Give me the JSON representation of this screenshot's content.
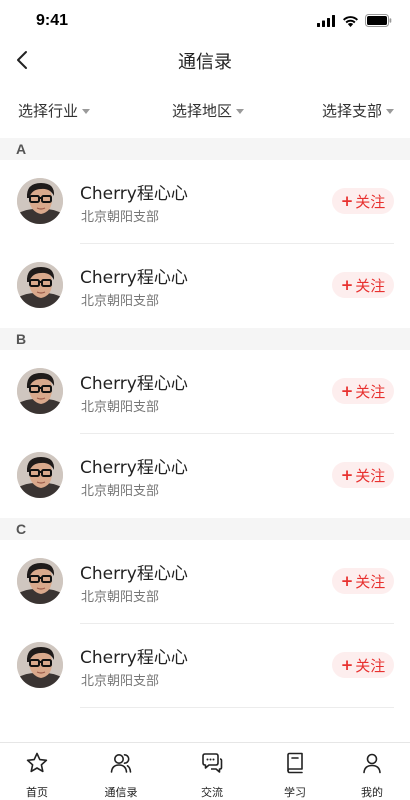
{
  "status_bar": {
    "time": "9:41"
  },
  "nav": {
    "title": "通信录"
  },
  "filters": {
    "industry": "选择行业",
    "region": "选择地区",
    "branch": "选择支部"
  },
  "sections": [
    {
      "letter": "A",
      "contacts": [
        {
          "name": "Cherry程心心",
          "branch": "北京朝阳支部",
          "follow": "关注"
        },
        {
          "name": "Cherry程心心",
          "branch": "北京朝阳支部",
          "follow": "关注"
        }
      ]
    },
    {
      "letter": "B",
      "contacts": [
        {
          "name": "Cherry程心心",
          "branch": "北京朝阳支部",
          "follow": "关注"
        },
        {
          "name": "Cherry程心心",
          "branch": "北京朝阳支部",
          "follow": "关注"
        }
      ]
    },
    {
      "letter": "C",
      "contacts": [
        {
          "name": "Cherry程心心",
          "branch": "北京朝阳支部",
          "follow": "关注"
        },
        {
          "name": "Cherry程心心",
          "branch": "北京朝阳支部",
          "follow": "关注"
        }
      ]
    }
  ],
  "tabbar": {
    "home": "首页",
    "contacts": "通信录",
    "chat": "交流",
    "learn": "学习",
    "mine": "我的"
  },
  "colors": {
    "accent": "#e8312f",
    "accent_bg": "#fdeeee",
    "section_bg": "#f5f5f5"
  }
}
